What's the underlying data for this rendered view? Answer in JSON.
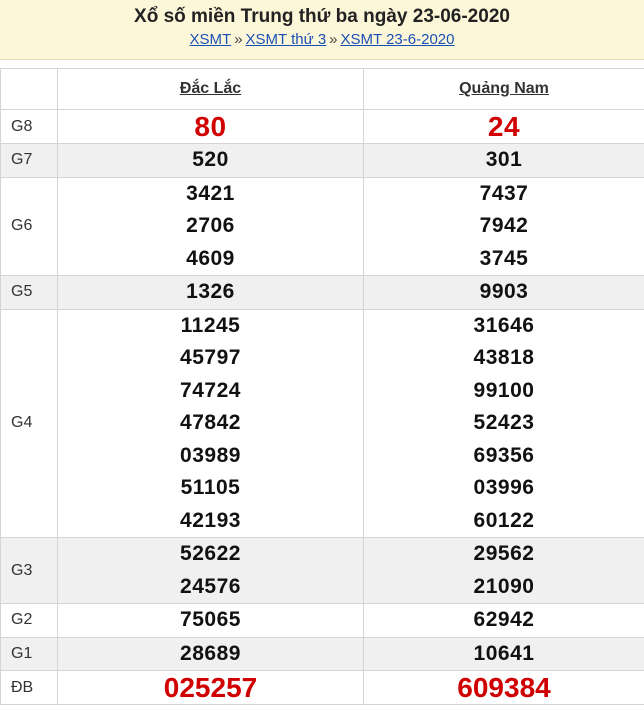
{
  "header": {
    "title": "Xổ số miền Trung thứ ba ngày 23-06-2020",
    "breadcrumbs": [
      "XSMT",
      "XSMT thứ 3",
      "XSMT 23-6-2020"
    ],
    "separator": "»"
  },
  "table": {
    "columns": [
      "Đắc Lắc",
      "Quảng Nam"
    ],
    "rows": [
      {
        "prize": "G8",
        "a": [
          "80"
        ],
        "b": [
          "24"
        ]
      },
      {
        "prize": "G7",
        "a": [
          "520"
        ],
        "b": [
          "301"
        ]
      },
      {
        "prize": "G6",
        "a": [
          "3421",
          "2706",
          "4609"
        ],
        "b": [
          "7437",
          "7942",
          "3745"
        ]
      },
      {
        "prize": "G5",
        "a": [
          "1326"
        ],
        "b": [
          "9903"
        ]
      },
      {
        "prize": "G4",
        "a": [
          "11245",
          "45797",
          "74724",
          "47842",
          "03989",
          "51105",
          "42193"
        ],
        "b": [
          "31646",
          "43818",
          "99100",
          "52423",
          "69356",
          "03996",
          "60122"
        ]
      },
      {
        "prize": "G3",
        "a": [
          "52622",
          "24576"
        ],
        "b": [
          "29562",
          "21090"
        ]
      },
      {
        "prize": "G2",
        "a": [
          "75065"
        ],
        "b": [
          "62942"
        ]
      },
      {
        "prize": "G1",
        "a": [
          "28689"
        ],
        "b": [
          "10641"
        ]
      },
      {
        "prize": "ĐB",
        "a": [
          "025257"
        ],
        "b": [
          "609384"
        ]
      }
    ]
  },
  "colors": {
    "header_bg": "#fdf7d9",
    "link": "#1a4fb5",
    "highlight": "#d00000",
    "alt_row": "#f0f0f0"
  }
}
